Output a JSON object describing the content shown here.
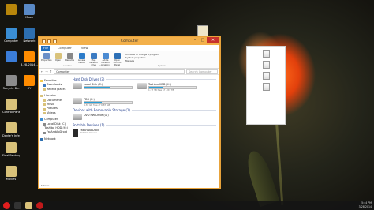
{
  "desktop_icons": [
    {
      "label": "",
      "color": "#b8860b"
    },
    {
      "label": "Moxa",
      "color": "#5a8ac6"
    },
    {
      "label": "Computer",
      "color": "#3a8ed4"
    },
    {
      "label": "Network",
      "color": "#2d6fb0"
    },
    {
      "label": "",
      "color": "#3b7dd8"
    },
    {
      "label": "3-28-2014...",
      "color": "#ff8c00"
    },
    {
      "label": "Recycle Bin",
      "color": "#8c8c8c"
    },
    {
      "label": "XY",
      "color": "#ff8c00"
    },
    {
      "label": "Control Panel",
      "color": "#d9c27a"
    },
    {
      "label": "Dante's Inferno...",
      "color": "#d9c27a"
    },
    {
      "label": "Final Fantasy Lightning R...",
      "color": "#d9c27a"
    },
    {
      "label": "Movies",
      "color": "#d9c27a"
    }
  ],
  "window": {
    "title": "Computer",
    "tabs": [
      "File",
      "Computer",
      "View"
    ],
    "ribbon": {
      "buttons": [
        {
          "label": "Properties",
          "color": "#6a8fc8"
        },
        {
          "label": "Open",
          "color": "#d9c27a"
        },
        {
          "label": "Rename",
          "color": "#888"
        },
        {
          "label": "Access media",
          "color": "#2b7bc9"
        },
        {
          "label": "Map network drive",
          "color": "#3a7ac2"
        },
        {
          "label": "Add a network location",
          "color": "#4a8ad2"
        },
        {
          "label": "Open Control Panel",
          "color": "#2c6fb6"
        }
      ],
      "list": [
        "Uninstall or change a program",
        "System properties",
        "Manage"
      ],
      "groups": [
        "Location",
        "Network",
        "System"
      ]
    },
    "address": "Computer",
    "search_placeholder": "Search Computer",
    "nav_pane": [
      {
        "label": "Favorites",
        "color": "#f2c94c",
        "header": true
      },
      {
        "label": "Downloads",
        "color": "#3a7ac2"
      },
      {
        "label": "Recent places",
        "color": "#d9c27a"
      },
      {
        "label": "Libraries",
        "color": "#d9c27a",
        "header": true
      },
      {
        "label": "Documents",
        "color": "#d9c27a"
      },
      {
        "label": "Music",
        "color": "#d9c27a"
      },
      {
        "label": "Pictures",
        "color": "#d9c27a"
      },
      {
        "label": "Videos",
        "color": "#d9c27a"
      },
      {
        "label": "Computer",
        "color": "#3a8ed4",
        "header": true
      },
      {
        "label": "Local Disk (C:)",
        "color": "#888"
      },
      {
        "label": "Toshiba HDD (H:)",
        "color": "#888"
      },
      {
        "label": "FatAndAoDroid",
        "color": "#888"
      },
      {
        "label": "Network",
        "color": "#2d6fb0",
        "header": true
      }
    ],
    "sections": {
      "hdd": "Hard Disk Drives (3)",
      "removable": "Devices with Removable Storage (1)",
      "portable": "Portable Devices (1)"
    },
    "drives": [
      {
        "name": "Local Disk (C:)",
        "size": "",
        "fill": 0.55
      },
      {
        "name": "Toshiba HDD (H:)",
        "size": "1.27 TB free of 1.81 TB",
        "fill": 0.3
      },
      {
        "name": "PDS (E:)",
        "size": "4.30 GB free of 6.87 GB",
        "fill": 0.37
      }
    ],
    "removable": {
      "name": "DVD RW Drive (G:)"
    },
    "portable": {
      "name": "FatAndAoDroid",
      "sub": "Portable Device"
    },
    "status": "5 items"
  },
  "right_panel": [
    {
      "label": ""
    },
    {
      "label": ""
    },
    {
      "label": ""
    },
    {
      "label": ""
    }
  ],
  "taskbar": {
    "time": "5:44 PM",
    "date": "3/28/2014"
  }
}
